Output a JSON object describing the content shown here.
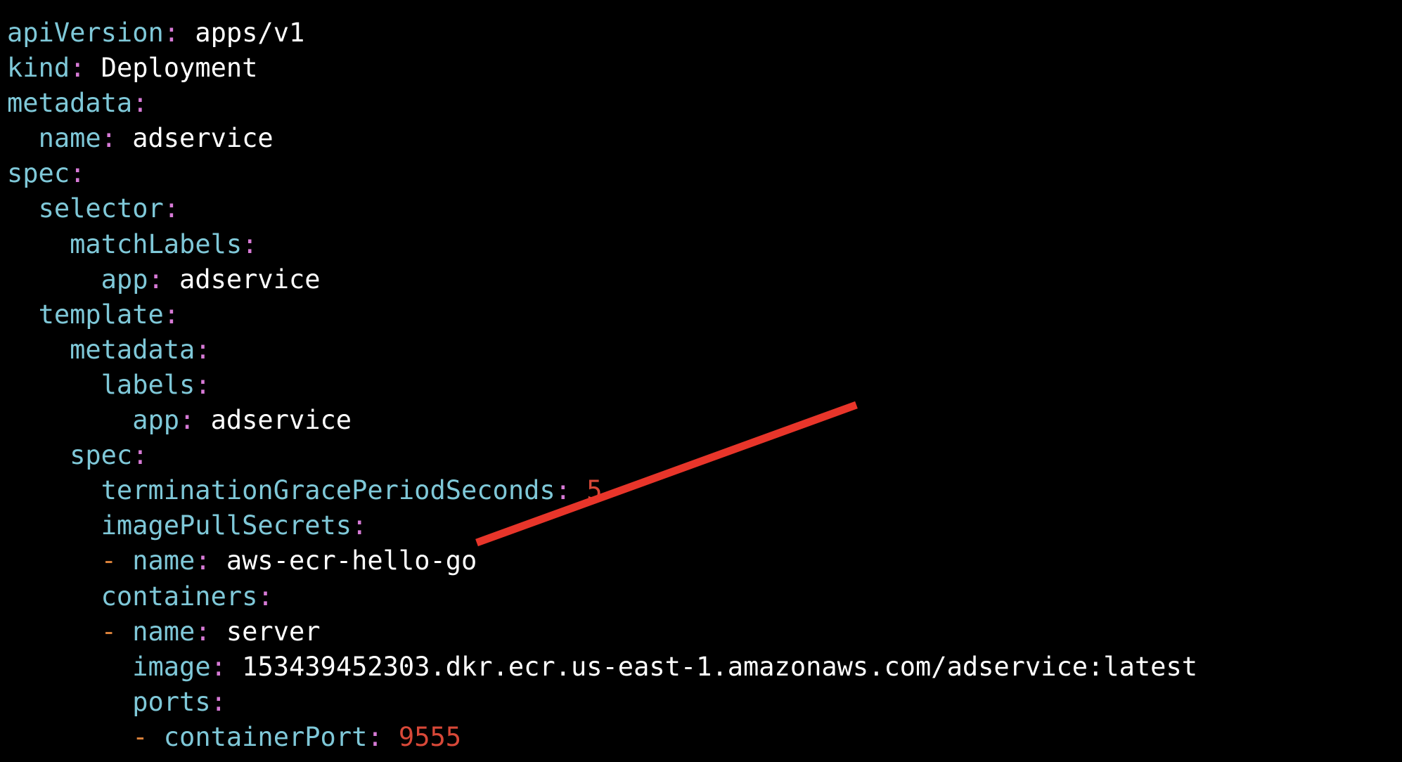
{
  "colors": {
    "background": "#000000",
    "key": "#7fc8d8",
    "colon": "#d77ad6",
    "dash": "#d9803a",
    "value": "#ffffff",
    "number": "#d84838",
    "annotation": "#e8352a"
  },
  "lines": [
    {
      "indent": "",
      "dash": "",
      "key": "apiVersion",
      "colon": ":",
      "value": " apps/v1",
      "type": "val"
    },
    {
      "indent": "",
      "dash": "",
      "key": "kind",
      "colon": ":",
      "value": " Deployment",
      "type": "val"
    },
    {
      "indent": "",
      "dash": "",
      "key": "metadata",
      "colon": ":",
      "value": "",
      "type": "val"
    },
    {
      "indent": "  ",
      "dash": "",
      "key": "name",
      "colon": ":",
      "value": " adservice",
      "type": "val"
    },
    {
      "indent": "",
      "dash": "",
      "key": "spec",
      "colon": ":",
      "value": "",
      "type": "val"
    },
    {
      "indent": "  ",
      "dash": "",
      "key": "selector",
      "colon": ":",
      "value": "",
      "type": "val"
    },
    {
      "indent": "    ",
      "dash": "",
      "key": "matchLabels",
      "colon": ":",
      "value": "",
      "type": "val"
    },
    {
      "indent": "      ",
      "dash": "",
      "key": "app",
      "colon": ":",
      "value": " adservice",
      "type": "val"
    },
    {
      "indent": "  ",
      "dash": "",
      "key": "template",
      "colon": ":",
      "value": "",
      "type": "val"
    },
    {
      "indent": "    ",
      "dash": "",
      "key": "metadata",
      "colon": ":",
      "value": "",
      "type": "val"
    },
    {
      "indent": "      ",
      "dash": "",
      "key": "labels",
      "colon": ":",
      "value": "",
      "type": "val"
    },
    {
      "indent": "        ",
      "dash": "",
      "key": "app",
      "colon": ":",
      "value": " adservice",
      "type": "val"
    },
    {
      "indent": "    ",
      "dash": "",
      "key": "spec",
      "colon": ":",
      "value": "",
      "type": "val"
    },
    {
      "indent": "      ",
      "dash": "",
      "key": "terminationGracePeriodSeconds",
      "colon": ":",
      "value": " 5",
      "type": "num"
    },
    {
      "indent": "      ",
      "dash": "",
      "key": "imagePullSecrets",
      "colon": ":",
      "value": "",
      "type": "val"
    },
    {
      "indent": "      ",
      "dash": "- ",
      "key": "name",
      "colon": ":",
      "value": " aws-ecr-hello-go",
      "type": "val"
    },
    {
      "indent": "      ",
      "dash": "",
      "key": "containers",
      "colon": ":",
      "value": "",
      "type": "val"
    },
    {
      "indent": "      ",
      "dash": "- ",
      "key": "name",
      "colon": ":",
      "value": " server",
      "type": "val"
    },
    {
      "indent": "        ",
      "dash": "",
      "key": "image",
      "colon": ":",
      "value": " 153439452303.dkr.ecr.us-east-1.amazonaws.com/adservice:latest",
      "type": "val"
    },
    {
      "indent": "        ",
      "dash": "",
      "key": "ports",
      "colon": ":",
      "value": "",
      "type": "val"
    },
    {
      "indent": "        ",
      "dash": "- ",
      "key": "containerPort",
      "colon": ":",
      "value": " 9555",
      "type": "num"
    }
  ]
}
